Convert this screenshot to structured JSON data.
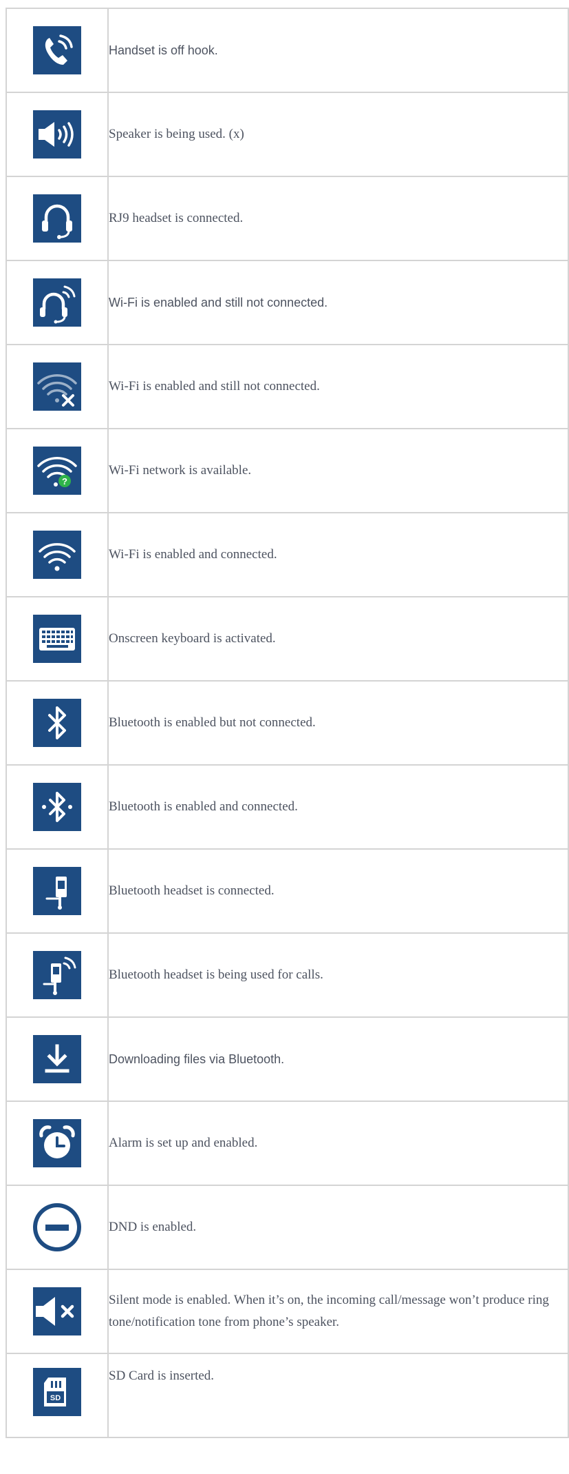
{
  "rows": [
    {
      "icon": "handset-off-hook-icon",
      "text": "Handset is off hook."
    },
    {
      "icon": "speaker-icon",
      "text": "Speaker is being used. (x)"
    },
    {
      "icon": "rj9-headset-icon",
      "text": "RJ9 headset is connected."
    },
    {
      "icon": "headset-in-use-icon",
      "text": "Wi-Fi is enabled and still not connected."
    },
    {
      "icon": "wifi-not-connected-icon",
      "text": "Wi-Fi is enabled and still not connected."
    },
    {
      "icon": "wifi-available-icon",
      "text": "Wi-Fi network is available."
    },
    {
      "icon": "wifi-connected-icon",
      "text": "Wi-Fi is enabled and connected."
    },
    {
      "icon": "keyboard-icon",
      "text": "Onscreen keyboard is activated."
    },
    {
      "icon": "bluetooth-icon",
      "text": "Bluetooth is enabled but not connected."
    },
    {
      "icon": "bluetooth-connected-icon",
      "text": "Bluetooth is enabled and connected."
    },
    {
      "icon": "bluetooth-headset-icon",
      "text": "Bluetooth headset is connected."
    },
    {
      "icon": "bluetooth-headset-calling-icon",
      "text": "Bluetooth headset is being used for calls."
    },
    {
      "icon": "download-icon",
      "text": "Downloading files via Bluetooth."
    },
    {
      "icon": "alarm-clock-icon",
      "text": "Alarm is set up and enabled."
    },
    {
      "icon": "dnd-icon",
      "text": "DND is enabled."
    },
    {
      "icon": "silent-mode-icon",
      "text": "Silent mode is enabled. When it’s on, the incoming call/message won’t produce ring tone/notification tone from phone’s speaker."
    },
    {
      "icon": "sd-card-icon",
      "text": "SD Card is inserted."
    }
  ],
  "colors": {
    "icon_background": "#1e4c82",
    "icon_foreground": "#ffffff",
    "text": "#4d5360",
    "border": "#d4d4d4",
    "accent_green": "#2fb34a"
  }
}
